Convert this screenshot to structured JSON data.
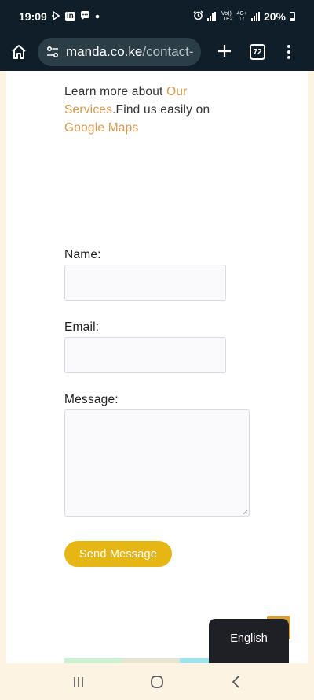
{
  "status_bar": {
    "time": "19:09",
    "battery": "20%",
    "network_top": "Vo))",
    "network_bottom": "LTE2",
    "network_gen": "4G+"
  },
  "browser": {
    "url_domain": "manda.co.ke",
    "url_path": "/contact-",
    "tab_count": "72"
  },
  "intro": {
    "text_before": "Learn more about ",
    "link_services": "Our Services",
    "text_middle": ".Find us easily on ",
    "link_maps": "Google Maps"
  },
  "form": {
    "name_label": "Name:",
    "email_label": "Email:",
    "message_label": "Message:",
    "submit_label": "Send Message"
  },
  "language_popup": {
    "label": "English"
  },
  "colors": {
    "accent_gold": "#e6b615",
    "link_color": "#d19a4f",
    "browser_bg": "#0f1e28"
  }
}
